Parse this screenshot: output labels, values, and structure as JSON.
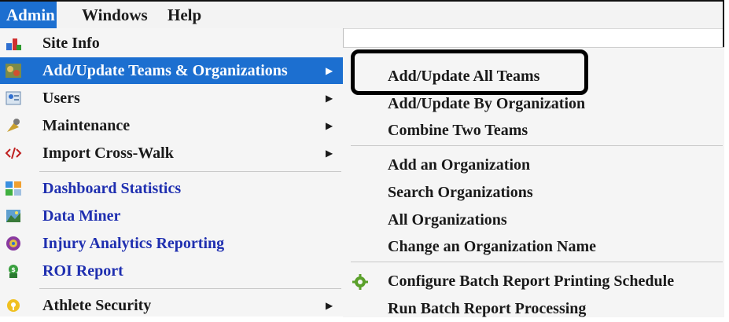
{
  "menubar": {
    "items": [
      {
        "label": "Admin",
        "active": true
      },
      {
        "label": "Windows",
        "active": false
      },
      {
        "label": "Help",
        "active": false
      }
    ]
  },
  "admin_menu": {
    "items": [
      {
        "label": "Site Info",
        "icon": "site-info-icon",
        "submenu": false
      },
      {
        "label": "Add/Update Teams & Organizations",
        "icon": "teams-icon",
        "submenu": true
      },
      {
        "label": "Users",
        "icon": "users-icon",
        "submenu": true
      },
      {
        "label": "Maintenance",
        "icon": "maintenance-icon",
        "submenu": true
      },
      {
        "label": "Import Cross-Walk",
        "icon": "code-icon",
        "submenu": true
      },
      {
        "label": "Dashboard Statistics",
        "icon": "dashboard-icon",
        "submenu": false
      },
      {
        "label": "Data Miner",
        "icon": "data-miner-icon",
        "submenu": false
      },
      {
        "label": "Injury Analytics Reporting",
        "icon": "injury-analytics-icon",
        "submenu": false
      },
      {
        "label": "ROI Report",
        "icon": "roi-icon",
        "submenu": false
      },
      {
        "label": "Athlete Security",
        "icon": "athlete-security-icon",
        "submenu": true
      }
    ]
  },
  "teams_submenu": {
    "items": [
      {
        "label": "Add/Update All Teams"
      },
      {
        "label": "Add/Update By Organization"
      },
      {
        "label": "Combine Two Teams"
      },
      {
        "label": "Add an Organization"
      },
      {
        "label": "Search Organizations"
      },
      {
        "label": "All Organizations"
      },
      {
        "label": "Change an Organization Name"
      },
      {
        "label": "Configure Batch Report Printing Schedule",
        "icon": "gear-icon"
      },
      {
        "label": "Run Batch Report Processing"
      }
    ]
  },
  "colors": {
    "accent": "#1c6fd0",
    "link_blue": "#1f2fb0",
    "highlight_border": "#000000"
  }
}
